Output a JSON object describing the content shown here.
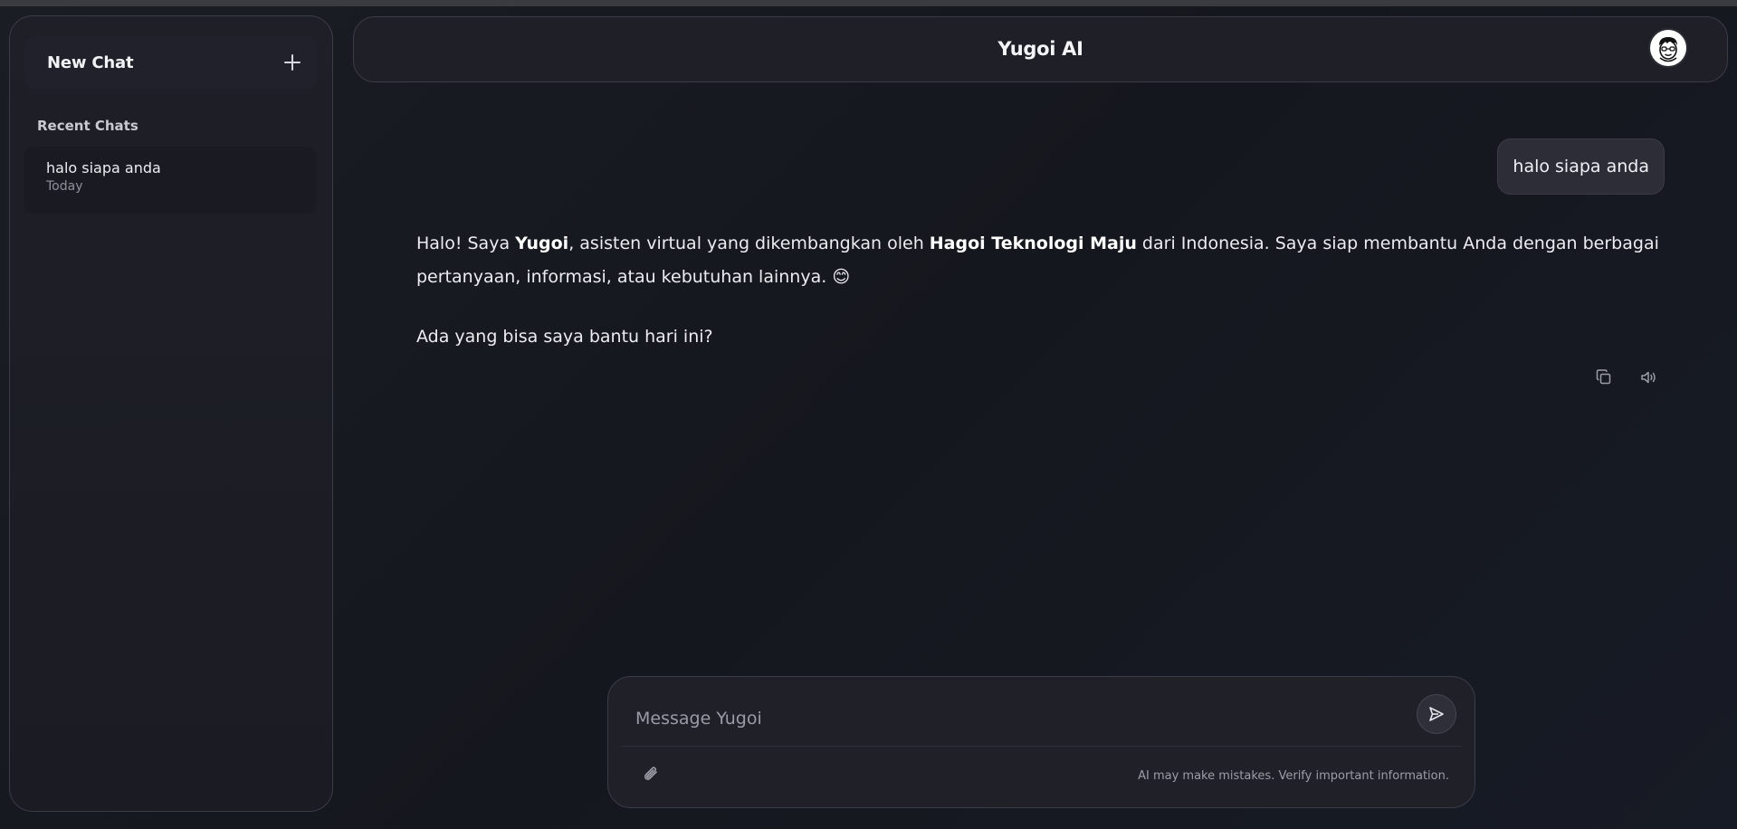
{
  "app": {
    "title": "Yugoi AI"
  },
  "sidebar": {
    "new_chat_label": "New Chat",
    "new_chat_icon": "plus-icon",
    "recent_title": "Recent Chats",
    "recent_chats": [
      {
        "title": "halo siapa anda",
        "date": "Today"
      }
    ]
  },
  "header": {
    "title": "Yugoi AI",
    "avatar_icon": "user-avatar-icon"
  },
  "conversation": {
    "user_message": "halo siapa anda",
    "assistant_message": {
      "p1_before_name": "Halo! Saya ",
      "name": "Yugoi",
      "p1_middle": ", asisten virtual yang dikembangkan oleh ",
      "company": "Hagoi Teknologi Maju",
      "p1_after": " dari Indonesia. Saya siap membantu Anda dengan berbagai pertanyaan, informasi, atau kebutuhan lainnya.",
      "emoji": "😊",
      "p2": "Ada yang bisa saya bantu hari ini?"
    },
    "actions": [
      {
        "icon": "copy-icon"
      },
      {
        "icon": "speaker-icon"
      }
    ]
  },
  "composer": {
    "placeholder": "Message Yugoi",
    "value": "",
    "send_icon": "send-icon",
    "attach_icon": "paperclip-icon",
    "disclaimer": "AI may make mistakes. Verify important information."
  },
  "colors": {
    "background": "#161820",
    "panel": "#1e1f27",
    "border": "#3a3c46",
    "user_bubble": "#2c2d36",
    "text": "#ececf1",
    "muted": "#8e8f99"
  }
}
